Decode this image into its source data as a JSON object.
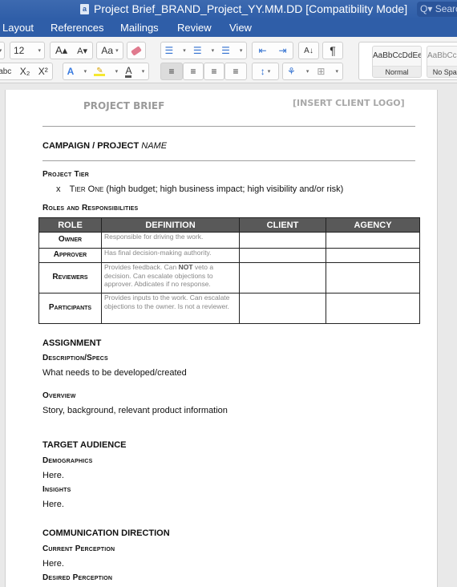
{
  "window": {
    "title": "Project Brief_BRAND_Project_YY.MM.DD [Compatibility Mode]",
    "doc_icon": "a",
    "search_placeholder": "Q▾ Search"
  },
  "ribbon_tabs": [
    "Layout",
    "References",
    "Mailings",
    "Review",
    "View"
  ],
  "toolbar": {
    "font_size": "12",
    "grow_font": "A▴",
    "shrink_font": "A▾",
    "change_case": "Aa",
    "strikethrough": "abc",
    "subscript": "X₂",
    "superscript": "X²",
    "text_effects": "A",
    "font_color": "A",
    "bullets": "☰",
    "numbering": "☰",
    "multilevel": "☰",
    "decrease_indent": "⇤",
    "increase_indent": "⇥",
    "sort": "A↓",
    "show_marks": "¶",
    "align_left": "≡",
    "align_center": "≡",
    "align_right": "≡",
    "justify": "≡",
    "line_spacing": "↕",
    "shading": "⚘",
    "borders": "⊞",
    "styles": [
      {
        "sample": "AaBbCcDdEe",
        "name": "Normal"
      },
      {
        "sample": "AaBbCcDdEe",
        "name": "No Spacing"
      }
    ]
  },
  "document": {
    "header_title": "PROJECT BRIEF",
    "logo_placeholder": "[INSERT CLIENT LOGO]",
    "campaign_label": "CAMPAIGN / PROJECT",
    "campaign_name": "NAME",
    "project_tier_heading": "Project Tier",
    "tier_marker": "x",
    "tier_name": "Tier One",
    "tier_desc": "(high budget; high business impact; high visibility and/or risk)",
    "roles_heading": "Roles and Responsibilities",
    "roles_table": {
      "headers": [
        "ROLE",
        "DEFINITION",
        "CLIENT",
        "AGENCY"
      ],
      "rows": [
        {
          "role": "Owner",
          "definition": "Responsible for driving the work.",
          "client": "",
          "agency": ""
        },
        {
          "role": "Approver",
          "definition": "Has final decision-making authority.",
          "client": "",
          "agency": ""
        },
        {
          "role": "Reviewers",
          "definition_pre": "Provides feedback. Can ",
          "definition_bold": "NOT",
          "definition_post": " veto a decision. Can escalate objections to approver. Abdicates if no response.",
          "client": "",
          "agency": ""
        },
        {
          "role": "Participants",
          "definition": "Provides inputs to the work. Can escalate objections to the owner. Is not a reviewer.",
          "client": "",
          "agency": ""
        }
      ]
    },
    "assignment_heading": "ASSIGNMENT",
    "description_heading": "Description/Specs",
    "description_text": "What needs to be developed/created",
    "overview_heading": "Overview",
    "overview_text": "Story, background, relevant product information",
    "target_heading": "TARGET AUDIENCE",
    "demographics_heading": "Demographics",
    "demographics_text": "Here.",
    "insights_heading": "Insights",
    "insights_text": "Here.",
    "comm_heading": "COMMUNICATION DIRECTION",
    "current_perception_heading": "Current Perception",
    "current_perception_text": "Here.",
    "desired_perception_heading": "Desired Perception"
  }
}
